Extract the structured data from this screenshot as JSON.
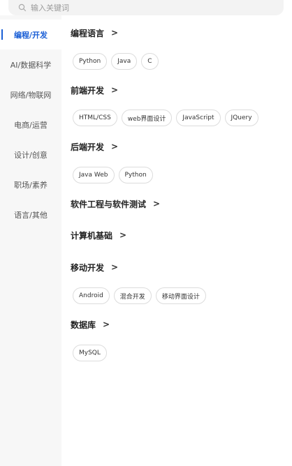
{
  "search": {
    "placeholder": "输入关键词"
  },
  "sidebar": {
    "items": [
      {
        "label": "编程/开发",
        "active": true
      },
      {
        "label": "AI/数据科学",
        "active": false
      },
      {
        "label": "网络/物联网",
        "active": false
      },
      {
        "label": "电商/运营",
        "active": false
      },
      {
        "label": "设计/创意",
        "active": false
      },
      {
        "label": "职场/素养",
        "active": false
      },
      {
        "label": "语言/其他",
        "active": false
      }
    ],
    "accent_color": "#1a5fd6"
  },
  "sections": [
    {
      "title": "编程语言",
      "tags": [
        "Python",
        "Java",
        "C"
      ]
    },
    {
      "title": "前端开发",
      "tags": [
        "HTML/CSS",
        "web界面设计",
        "JavaScript",
        "JQuery"
      ]
    },
    {
      "title": "后端开发",
      "tags": [
        "Java Web",
        "Python"
      ]
    },
    {
      "title": "软件工程与软件测试",
      "tags": []
    },
    {
      "title": "计算机基础",
      "tags": []
    },
    {
      "title": "移动开发",
      "tags": [
        "Android",
        "混合开发",
        "移动界面设计"
      ]
    },
    {
      "title": "数据库",
      "tags": [
        "MySQL"
      ]
    }
  ],
  "chevron_glyph": ">"
}
